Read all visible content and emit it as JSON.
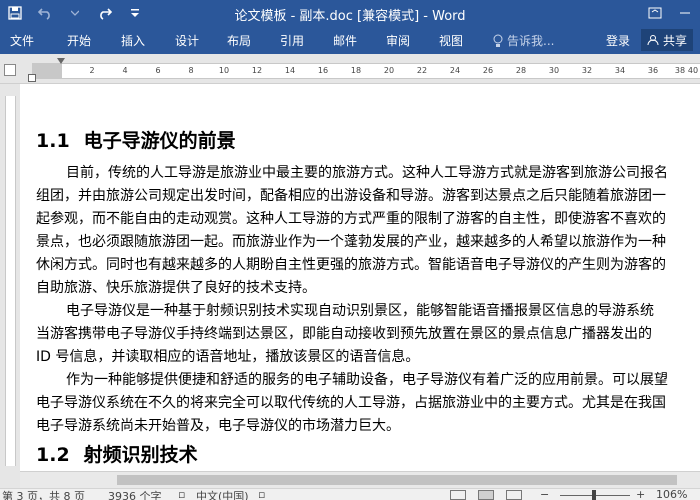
{
  "window": {
    "title": "论文模板 - 副本.doc [兼容模式] - Word"
  },
  "ribbon": {
    "tabs": [
      "文件",
      "开始",
      "插入",
      "设计",
      "布局",
      "引用",
      "邮件",
      "审阅",
      "视图"
    ],
    "tell_me": "告诉我...",
    "sign_in": "登录",
    "share": "共享"
  },
  "ruler": {
    "ticks": [
      "2",
      "4",
      "6",
      "8",
      "10",
      "12",
      "14",
      "16",
      "18",
      "20",
      "22",
      "24",
      "26",
      "28",
      "30",
      "32",
      "34",
      "36",
      "38",
      "40"
    ]
  },
  "document": {
    "heading1": {
      "number": "1.1",
      "text": "电子导游仪的前景"
    },
    "p1": [
      "目前，传统的人工导游是旅游业中最主要的旅游方式。这种人工导游方式就是游客到旅游公司报名",
      "组团，并由旅游公司规定出发时间，配备相应的出游设备和导游。游客到达景点之后只能随着旅游团一",
      "起参观，而不能自由的走动观赏。这种人工导游的方式严重的限制了游客的自主性，即使游客不喜欢的",
      "景点，也必须跟随旅游团一起。而旅游业作为一个蓬勃发展的产业，越来越多的人希望以旅游作为一种",
      "休闲方式。同时也有越来越多的人期盼自主性更强的旅游方式。智能语音电子导游仪的产生则为游客的",
      "自助旅游、快乐旅游提供了良好的技术支持。"
    ],
    "p2": [
      "电子导游仪是一种基于射频识别技术实现自动识别景区，能够智能语音播报景区信息的导游系统",
      "当游客携带电子导游仪手持终端到达景区，即能自动接收到预先放置在景区的景点信息广播器发出的",
      "ID 号信息，并读取相应的语音地址，播放该景区的语音信息。"
    ],
    "p3": [
      "作为一种能够提供便捷和舒适的服务的电子辅助设备，电子导游仪有着广泛的应用前景。可以展望",
      "电子导游仪系统在不久的将来完全可以取代传统的人工导游，占据旅游业中的主要方式。尤其是在我国",
      "电子导游系统尚未开始普及，电子导游仪的市场潜力巨大。"
    ],
    "heading2": {
      "number": "1.2",
      "text": "射频识别技术"
    }
  },
  "status": {
    "page": "第 3 页，共 8 页",
    "words": "3936 个字",
    "language": "中文(中国)",
    "zoom": "106%"
  }
}
